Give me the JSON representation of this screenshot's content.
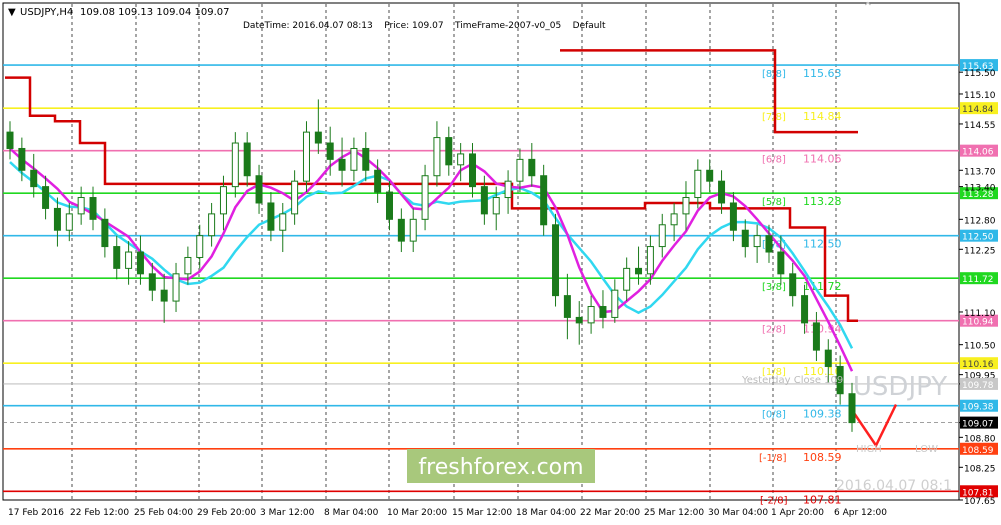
{
  "header": {
    "symbol_label": "USDJPY,H4",
    "ohlc": "109.08 109.13 109.04 109.07",
    "info": "DateTime: 2016.04.07 08:13    Price: 109.07    TimeFrame-2007-v0_05    Default"
  },
  "watermarks": {
    "brand": "freshforex.com",
    "symbol": "USDJPY",
    "datetime": "2016.04.07 08:1",
    "yesterday_close": "Yesterday Close 109"
  },
  "colors": {
    "candle": "#1a7a1a",
    "candle_red": "#d22020",
    "ma_magenta": "#e020e0",
    "ma_cyan": "#30d8f0",
    "step_red": "#d20000",
    "v_red": "#ff2020",
    "brand_bg": "#a8c87c"
  },
  "chart_data": {
    "type": "candlestick",
    "title": "USDJPY,H4",
    "ylim": [
      107.65,
      116.0
    ],
    "y_ticks": [
      "115.63",
      "115.50",
      "115.10",
      "114.84",
      "114.55",
      "114.06",
      "113.70",
      "113.40",
      "113.28",
      "112.80",
      "112.50",
      "112.25",
      "111.72",
      "111.10",
      "110.94",
      "110.50",
      "110.16",
      "109.95",
      "109.78",
      "109.38",
      "109.07",
      "108.80",
      "108.59",
      "108.25",
      "107.81",
      "107.65"
    ],
    "x_labels": [
      "17 Feb 2016",
      "22 Feb 12:00",
      "25 Feb 04:00",
      "29 Feb 20:00",
      "3 Mar 12:00",
      "8 Mar 04:00",
      "10 Mar 20:00",
      "15 Mar 12:00",
      "18 Mar 04:00",
      "22 Mar 20:00",
      "25 Mar 12:00",
      "30 Mar 04:00",
      "1 Apr 20:00",
      "6 Apr 12:00"
    ],
    "murray_levels": [
      {
        "label": "[8/8]",
        "value": 115.63,
        "text": "115.63",
        "color": "#30b8e8"
      },
      {
        "label": "[7/8]",
        "value": 114.84,
        "text": "114.84",
        "color": "#f8f020"
      },
      {
        "label": "[6/8]",
        "value": 114.06,
        "text": "114.06",
        "color": "#f070b0"
      },
      {
        "label": "[5/8]",
        "value": 113.28,
        "text": "113.28",
        "color": "#20d820"
      },
      {
        "label": "[4/8]",
        "value": 112.5,
        "text": "112.50",
        "color": "#30b8e8"
      },
      {
        "label": "[3/8]",
        "value": 111.72,
        "text": "111.72",
        "color": "#20d820"
      },
      {
        "label": "[2/8]",
        "value": 110.94,
        "text": "110.94",
        "color": "#f070b0"
      },
      {
        "label": "[1/8]",
        "value": 110.16,
        "text": "110.16",
        "color": "#f8f020"
      },
      {
        "label": "[0/8]",
        "value": 109.38,
        "text": "109.38",
        "color": "#30b8e8"
      },
      {
        "label": "[-1/8]",
        "value": 108.59,
        "text": "108.59",
        "color": "#ff4010"
      },
      {
        "label": "[-2/8]",
        "value": 107.81,
        "text": "107.81",
        "color": "#e00000"
      }
    ],
    "current_price": 109.07,
    "yesterday_close": 109.78,
    "high_label": "HIGH",
    "low_label": "LOW",
    "candles": [
      [
        114.4,
        114.6,
        113.9,
        114.1
      ],
      [
        114.1,
        114.3,
        113.5,
        113.7
      ],
      [
        113.7,
        114.0,
        113.2,
        113.4
      ],
      [
        113.4,
        113.6,
        112.8,
        113.0
      ],
      [
        113.0,
        113.2,
        112.3,
        112.6
      ],
      [
        112.6,
        113.1,
        112.4,
        112.9
      ],
      [
        112.9,
        113.4,
        112.7,
        113.2
      ],
      [
        113.2,
        113.4,
        112.6,
        112.8
      ],
      [
        112.8,
        113.0,
        112.1,
        112.3
      ],
      [
        112.3,
        112.5,
        111.7,
        111.9
      ],
      [
        111.9,
        112.4,
        111.6,
        112.2
      ],
      [
        112.2,
        112.5,
        111.6,
        111.8
      ],
      [
        111.8,
        112.0,
        111.3,
        111.5
      ],
      [
        111.5,
        111.8,
        110.9,
        111.3
      ],
      [
        111.3,
        112.0,
        111.1,
        111.8
      ],
      [
        111.8,
        112.3,
        111.6,
        112.1
      ],
      [
        112.1,
        112.7,
        111.9,
        112.5
      ],
      [
        112.5,
        113.1,
        112.3,
        112.9
      ],
      [
        112.9,
        113.6,
        112.6,
        113.4
      ],
      [
        113.4,
        114.4,
        113.2,
        114.2
      ],
      [
        114.2,
        114.4,
        113.4,
        113.6
      ],
      [
        113.6,
        113.8,
        112.9,
        113.1
      ],
      [
        113.1,
        113.3,
        112.4,
        112.6
      ],
      [
        112.6,
        113.1,
        112.2,
        112.9
      ],
      [
        112.9,
        113.7,
        112.7,
        113.5
      ],
      [
        113.5,
        114.6,
        113.3,
        114.4
      ],
      [
        114.4,
        115.0,
        114.0,
        114.2
      ],
      [
        114.2,
        114.5,
        113.6,
        113.9
      ],
      [
        113.9,
        114.3,
        113.4,
        113.7
      ],
      [
        113.7,
        114.3,
        113.5,
        114.1
      ],
      [
        114.1,
        114.4,
        113.5,
        113.7
      ],
      [
        113.7,
        113.9,
        113.1,
        113.3
      ],
      [
        113.3,
        113.5,
        112.6,
        112.8
      ],
      [
        112.8,
        113.0,
        112.2,
        112.4
      ],
      [
        112.4,
        113.0,
        112.2,
        112.8
      ],
      [
        112.8,
        113.8,
        112.6,
        113.6
      ],
      [
        113.6,
        114.6,
        113.4,
        114.3
      ],
      [
        114.3,
        114.5,
        113.6,
        113.8
      ],
      [
        113.8,
        114.2,
        113.5,
        114.0
      ],
      [
        114.0,
        114.2,
        113.2,
        113.4
      ],
      [
        113.4,
        113.6,
        112.7,
        112.9
      ],
      [
        112.9,
        113.4,
        112.6,
        113.2
      ],
      [
        113.2,
        113.7,
        112.9,
        113.5
      ],
      [
        113.5,
        114.1,
        113.3,
        113.9
      ],
      [
        113.9,
        114.2,
        113.4,
        113.6
      ],
      [
        113.6,
        113.8,
        112.5,
        112.7
      ],
      [
        112.7,
        112.9,
        111.2,
        111.4
      ],
      [
        111.4,
        111.8,
        110.6,
        111.0
      ],
      [
        111.0,
        111.3,
        110.5,
        110.9
      ],
      [
        110.9,
        111.4,
        110.7,
        111.2
      ],
      [
        111.2,
        111.5,
        110.8,
        111.0
      ],
      [
        111.0,
        111.7,
        110.9,
        111.5
      ],
      [
        111.5,
        112.1,
        111.3,
        111.9
      ],
      [
        111.9,
        112.3,
        111.6,
        111.8
      ],
      [
        111.8,
        112.5,
        111.6,
        112.3
      ],
      [
        112.3,
        112.9,
        112.1,
        112.7
      ],
      [
        112.7,
        113.1,
        112.4,
        112.9
      ],
      [
        112.9,
        113.5,
        112.6,
        113.2
      ],
      [
        113.2,
        113.9,
        113.0,
        113.7
      ],
      [
        113.7,
        113.9,
        113.3,
        113.5
      ],
      [
        113.5,
        113.7,
        112.9,
        113.1
      ],
      [
        113.1,
        113.3,
        112.4,
        112.6
      ],
      [
        112.6,
        112.8,
        112.1,
        112.3
      ],
      [
        112.3,
        112.7,
        112.0,
        112.5
      ],
      [
        112.5,
        112.7,
        112.0,
        112.2
      ],
      [
        112.2,
        112.5,
        111.6,
        111.8
      ],
      [
        111.8,
        112.0,
        111.2,
        111.4
      ],
      [
        111.4,
        111.6,
        110.7,
        110.9
      ],
      [
        110.9,
        111.1,
        110.2,
        110.4
      ],
      [
        110.4,
        110.6,
        109.8,
        110.1
      ],
      [
        110.1,
        110.3,
        109.4,
        109.6
      ],
      [
        109.6,
        109.8,
        108.9,
        109.07
      ]
    ]
  }
}
